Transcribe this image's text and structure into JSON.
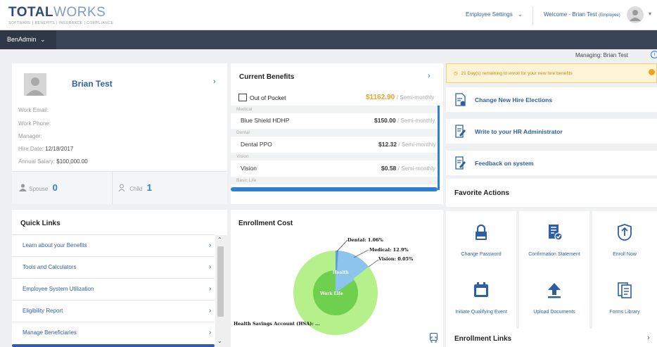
{
  "header": {
    "logo_main": "TOTAL",
    "logo_accent": "WORKS",
    "logo_tagline": "SOFTWARE | BENEFITS | INSURANCE | COMPLIANCE",
    "employee_settings": "Employee Settings",
    "welcome_label": "Welcome -",
    "welcome_name": "Brian Test",
    "welcome_role": "(Employee)"
  },
  "nav": {
    "item": "BenAdmin"
  },
  "managing": "Managing: Brian Test",
  "profile": {
    "name": "Brian Test",
    "work_email_label": "Work Email:",
    "work_phone_label": "Work Phone:",
    "manager_label": "Manager:",
    "hire_date_label": "Hire Date:",
    "hire_date": "12/18/2017",
    "salary_label": "Annual Salary:",
    "salary": "$100,000.00",
    "spouse_label": "Spouse",
    "spouse_count": "0",
    "child_label": "Child",
    "child_count": "1"
  },
  "benefits": {
    "title": "Current Benefits",
    "oop_label": "Out of Pocket",
    "oop_amount": "$1162.90",
    "oop_period": "/ Semi-monthly",
    "items": [
      {
        "category": "Medical",
        "name": "Blue Shield HDHP",
        "amount": "$150.00",
        "period": "/ Semi-monthly"
      },
      {
        "category": "Dental",
        "name": "Dental PPO",
        "amount": "$12.32",
        "period": "/ Semi-monthly"
      },
      {
        "category": "Vision",
        "name": "Vision",
        "amount": "$0.58",
        "period": "/ Semi-monthly"
      },
      {
        "category": "Basic Life"
      }
    ]
  },
  "alert": {
    "text": "21 Day(s) remaining to enroll for your new hire benefits"
  },
  "actions": [
    {
      "label": "Change New Hire Elections",
      "icon": "document-arrow-icon"
    },
    {
      "label": "Write to your HR Administrator",
      "icon": "pencil-document-icon"
    },
    {
      "label": "Feedback on system",
      "icon": "pencil-document-icon"
    }
  ],
  "favorites": {
    "title": "Favorite Actions",
    "tiles": [
      {
        "label": "Change Password",
        "icon": "lock-icon"
      },
      {
        "label": "Confirmation Statement",
        "icon": "checked-document-icon"
      },
      {
        "label": "Enroll Now",
        "icon": "enroll-icon"
      },
      {
        "label": "Initiate Qualifying Event",
        "icon": "calendar-icon"
      },
      {
        "label": "Upload Documents",
        "icon": "upload-icon"
      },
      {
        "label": "Forms Library",
        "icon": "forms-icon"
      }
    ]
  },
  "enrollment_links": {
    "title": "Enrollment Links"
  },
  "quick_links": {
    "title": "Quick Links",
    "items": [
      "Learn about your Benefits",
      "Tools and Calculators",
      "Employee System Utilization",
      "Eligibility Report",
      "Manage Beneficiaries"
    ]
  },
  "enrollment_cost": {
    "title": "Enrollment Cost",
    "labels": {
      "dental": "Dental: 1.06%",
      "medical": "Medical: 12.9%",
      "vision": "Vision: 0.05%",
      "hsa": "Health Savings Account (HSA): ...",
      "inner_health": "Health",
      "inner_worklife": "Work Life"
    }
  },
  "colors": {
    "brand_blue": "#2d5fa6",
    "accent_orange": "#e8a21f",
    "nav_dark": "#3a4555",
    "pie_light_green": "#b5f08a",
    "pie_dark_green": "#6fcf4e",
    "pie_blue": "#8cc4ee"
  }
}
